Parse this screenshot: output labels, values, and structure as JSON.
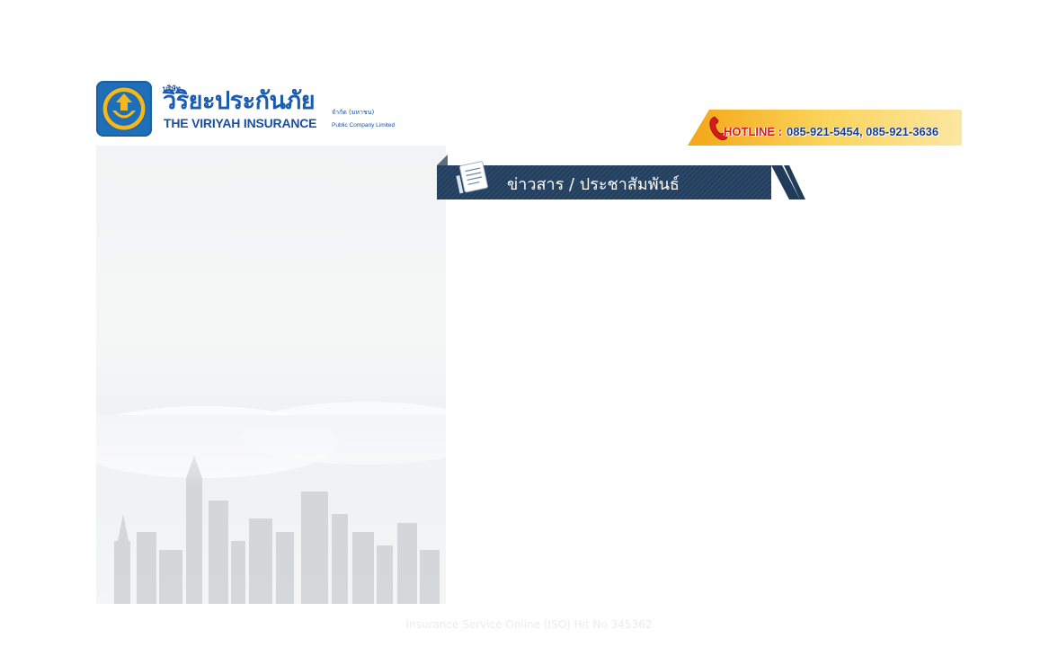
{
  "header": {
    "logo": {
      "thai_small": "บริษัท",
      "thai_name": "วิริยะประกันภัย",
      "thai_suffix": "จำกัด (มหาชน)",
      "english_name": "THE VIRIYAH INSURANCE",
      "english_suffix": "Public Company Limited"
    },
    "hotline": {
      "label": "HOTLINE :",
      "numbers": "085-921-5454, 085-921-3636"
    }
  },
  "news": {
    "title": "ข่าวสาร / ประชาสัมพันธ์"
  },
  "footer": {
    "text": "Insurance Service Online (ISO) Hit No 345362"
  },
  "colors": {
    "brand_blue": "#1f6fb8",
    "hotline_yellow": "#f5b81c",
    "news_navy": "#213c5a",
    "hotline_red": "#d71a1a"
  },
  "icons": [
    "viriyah-emblem-icon",
    "phone-icon",
    "notebook-icon"
  ]
}
